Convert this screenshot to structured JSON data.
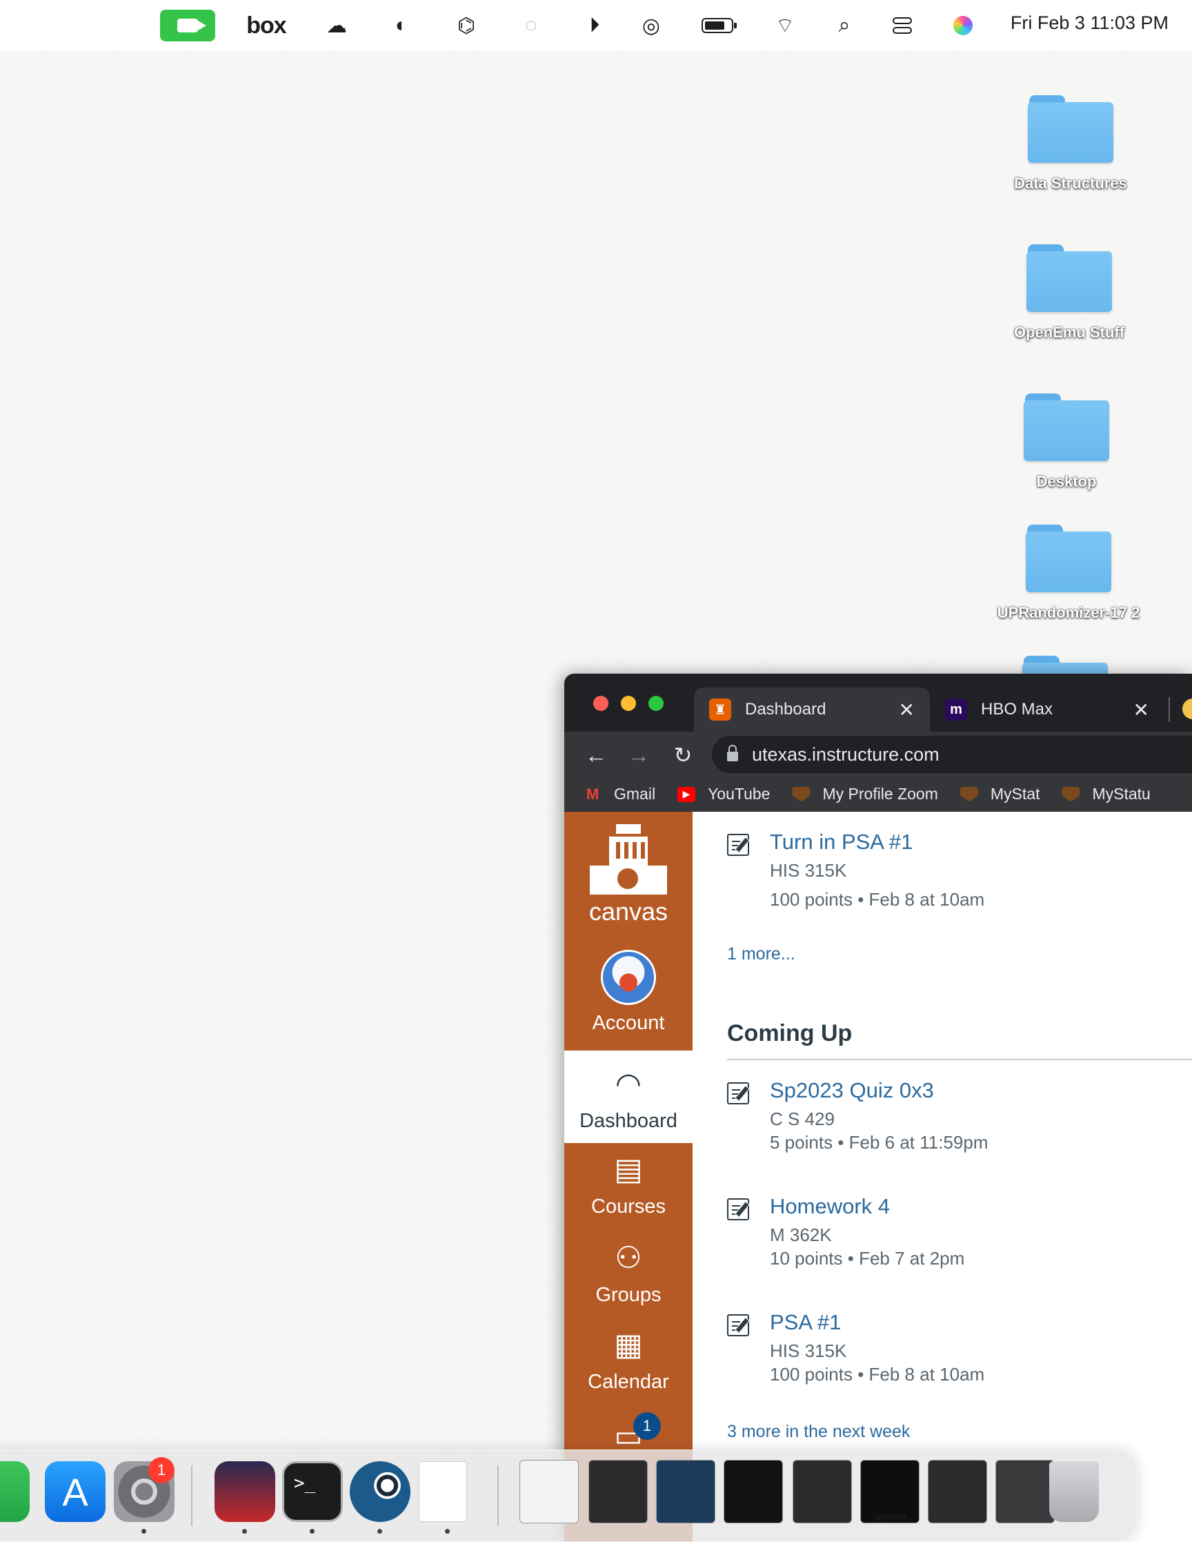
{
  "menubar": {
    "box_label": "box",
    "datetime": "Fri Feb 3  11:03 PM"
  },
  "desktop": {
    "folders": [
      {
        "label": "Data Structures"
      },
      {
        "label": "OpenEmu Stuff"
      },
      {
        "label": "Desktop"
      },
      {
        "label": "UPRandomizer-17 2"
      }
    ]
  },
  "browser": {
    "tabs": [
      {
        "title": "Dashboard",
        "close": "✕"
      },
      {
        "title": "HBO Max",
        "close": "✕"
      }
    ],
    "hbo_favicon": "m",
    "url": "utexas.instructure.com",
    "bookmarks": [
      {
        "label": "Gmail"
      },
      {
        "label": "YouTube"
      },
      {
        "label": "My Profile Zoom"
      },
      {
        "label": "MyStat"
      },
      {
        "label": "MyStatu"
      }
    ]
  },
  "canvas": {
    "logo_text": "canvas",
    "nav": {
      "account": "Account",
      "dashboard": "Dashboard",
      "courses": "Courses",
      "groups": "Groups",
      "calendar": "Calendar",
      "inbox_badge": "1"
    },
    "todo_top": {
      "title": "Turn in PSA #1",
      "course": "HIS 315K",
      "meta": "100 points • Feb 8 at 10am"
    },
    "more_link": "1 more...",
    "coming_up_heading": "Coming Up",
    "coming_up": [
      {
        "title": "Sp2023 Quiz 0x3",
        "course": "C S 429",
        "meta": "5 points • Feb 6 at 11:59pm"
      },
      {
        "title": "Homework 4",
        "course": "M 362K",
        "meta": "10 points • Feb 7 at 2pm"
      },
      {
        "title": "PSA #1",
        "course": "HIS 315K",
        "meta": "100 points • Feb 8 at 10am"
      }
    ],
    "more_next_week": "3 more in the next week"
  },
  "dock": {
    "settings_badge": "1",
    "python_label": "python..."
  },
  "colors": {
    "canvas_orange": "#b65a25",
    "link_blue": "#2b6a9f",
    "chrome_dark": "#202124"
  }
}
